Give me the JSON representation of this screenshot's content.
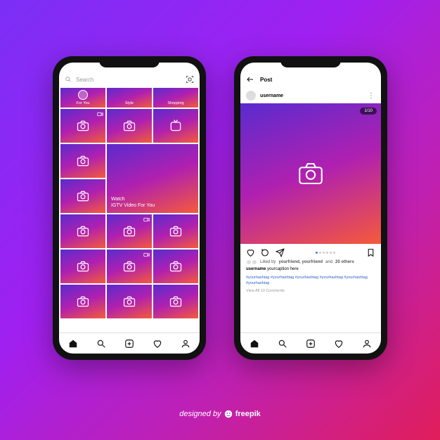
{
  "search": {
    "placeholder": "Search"
  },
  "explore_tabs": [
    "For You",
    "Style",
    "Shopping"
  ],
  "igtv": {
    "line1": "Watch",
    "line2": "IGTV Video For You"
  },
  "post": {
    "back_title": "Post",
    "username": "username",
    "counter": "1/10",
    "liked_by_prefix": "Liked by",
    "liked_by_names": "yourfriend, yourfriend",
    "liked_by_and": "and",
    "liked_by_count": "20 others",
    "caption_user": "username",
    "caption_text": "yourcaption here",
    "hashtags": "#yourhashtag #yourhashtag #yourhashtag #yourhashtag #yourhashtag #yourhashtag",
    "view_comments": "View All 10 Comments"
  },
  "credit": {
    "prefix": "designed by",
    "brand": "freepik"
  }
}
